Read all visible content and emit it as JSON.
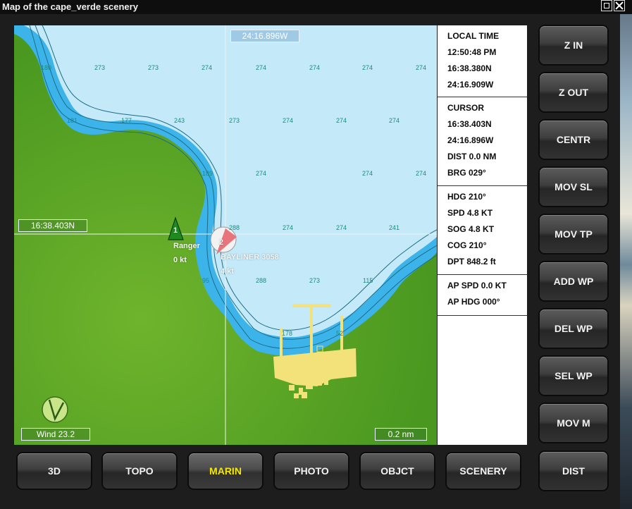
{
  "window": {
    "title": "Map of the cape_verde scenery"
  },
  "colors": {
    "land": "#58a624",
    "shallow": "#3bb3ea",
    "deep": "#c6ebfa",
    "active_label": "#f5e60a",
    "cursor_line": "#f0f0f0"
  },
  "map": {
    "cursor_lon": "24:16.896W",
    "cursor_lat": "16:38.403N",
    "wind": "Wind 23.2",
    "scale": "0.2 nm",
    "wind_icon": "wind-arrow-icon",
    "depths": [
      "180",
      "273",
      "273",
      "274",
      "274",
      "274",
      "274",
      "274",
      "181",
      "177",
      "243",
      "273",
      "274",
      "274",
      "274",
      "189",
      "274",
      "274",
      "274",
      "288",
      "274",
      "274",
      "241",
      "95",
      "288",
      "273",
      "115",
      "178",
      "52"
    ],
    "vessels": [
      {
        "num": "1",
        "name": "Ranger",
        "speed": "0 kt",
        "icon": "green-triangle-icon"
      },
      {
        "num": "2",
        "name": "BAYLINER 3058",
        "speed": "4 kt",
        "icon": "boat-marker-icon"
      }
    ]
  },
  "info": {
    "time": {
      "label": "LOCAL TIME",
      "clock": "12:50:48 PM",
      "lat": "16:38.380N",
      "lon": "24:16.909W"
    },
    "cursor": {
      "label": "CURSOR",
      "lat": "16:38.403N",
      "lon": "24:16.896W",
      "dist": "DIST 0.0 NM",
      "brg": "BRG 029°"
    },
    "nav": {
      "hdg": "HDG 210°",
      "spd": "SPD 4.8 KT",
      "sog": "SOG 4.8 KT",
      "cog": "COG 210°",
      "dpt": "DPT 848.2 ft"
    },
    "ap": {
      "spd": "AP SPD 0.0 KT",
      "hdg": "AP HDG 000°"
    }
  },
  "side_buttons": [
    "Z IN",
    "Z OUT",
    "CENTR",
    "MOV SL",
    "MOV TP",
    "ADD WP",
    "DEL WP",
    "SEL WP",
    "MOV M",
    "DIST"
  ],
  "bottom_buttons": [
    "3D",
    "TOPO",
    "MARIN",
    "PHOTO",
    "OBJCT",
    "SCENERY"
  ],
  "active_bottom": "MARIN"
}
